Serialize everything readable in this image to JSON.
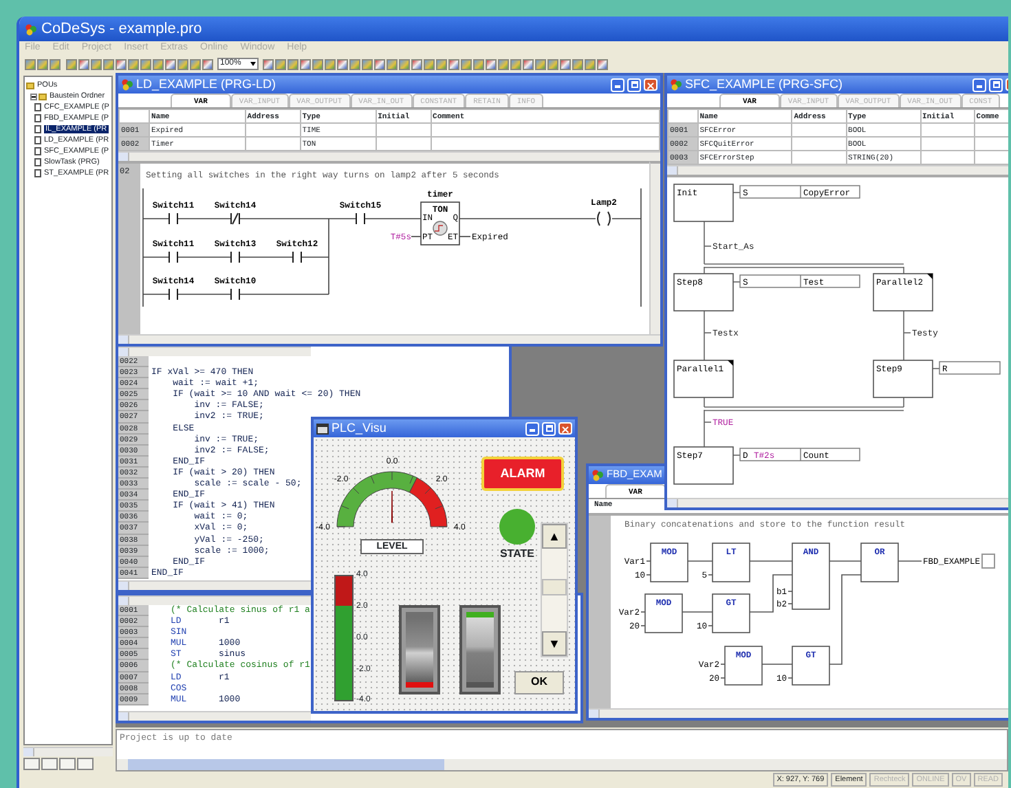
{
  "app": {
    "title": "CoDeSys - example.pro",
    "menu": [
      "File",
      "Edit",
      "Project",
      "Insert",
      "Extras",
      "Online",
      "Window",
      "Help"
    ],
    "zoom": "100%"
  },
  "pou_tree": {
    "label": "POUs",
    "children": [
      {
        "label": "Baustein Ordner",
        "expanded": true,
        "children": [
          {
            "label": "CFC_EXAMPLE (P",
            "selected": false
          },
          {
            "label": "FBD_EXAMPLE (P",
            "selected": false
          },
          {
            "label": "IL_EXAMPLE (PR",
            "selected": true
          },
          {
            "label": "LD_EXAMPLE (PR",
            "selected": false
          },
          {
            "label": "SFC_EXAMPLE (P",
            "selected": false
          },
          {
            "label": "SlowTask (PRG)",
            "selected": false
          },
          {
            "label": "ST_EXAMPLE (PR",
            "selected": false
          }
        ]
      }
    ]
  },
  "ld_window": {
    "title": "LD_EXAMPLE (PRG-LD)",
    "var_tabs": [
      {
        "label": "VAR",
        "selected": true
      },
      {
        "label": "VAR_INPUT",
        "selected": false
      },
      {
        "label": "VAR_OUTPUT",
        "selected": false
      },
      {
        "label": "VAR_IN_OUT",
        "selected": false
      },
      {
        "label": "CONSTANT",
        "selected": false
      },
      {
        "label": "RETAIN",
        "selected": false
      },
      {
        "label": "INFO",
        "selected": false
      }
    ],
    "columns": [
      "Name",
      "Address",
      "Type",
      "Initial",
      "Comment"
    ],
    "rows": [
      {
        "line": "0001",
        "name": "Expired",
        "type": "TIME"
      },
      {
        "line": "0002",
        "name": "Timer",
        "type": "TON"
      }
    ],
    "network": {
      "number": "02",
      "comment": "Setting all switches in the right way turns on lamp2 after 5 seconds",
      "branches": [
        [
          {
            "label": "Switch11",
            "negated": false
          },
          {
            "label": "Switch14",
            "negated": true
          }
        ],
        [
          {
            "label": "Switch11",
            "negated": false
          },
          {
            "label": "Switch13",
            "negated": false
          },
          {
            "label": "Switch12",
            "negated": false
          }
        ],
        [
          {
            "label": "Switch14",
            "negated": false
          },
          {
            "label": "Switch10",
            "negated": false
          }
        ]
      ],
      "series_contact": {
        "label": "Switch15",
        "negated": false
      },
      "block": {
        "instance": "timer",
        "type": "TON",
        "inputs": [
          "IN",
          "PT"
        ],
        "outputs": [
          "Q",
          "ET"
        ],
        "preset": "T#5s",
        "elapsed_output": "Expired"
      },
      "coil": "Lamp2"
    }
  },
  "st_window": {
    "lines": [
      {
        "line": "0022"
      },
      {
        "line": "0023",
        "code": "IF xVal >= 470 THEN"
      },
      {
        "line": "0024",
        "code": "    wait := wait +1;"
      },
      {
        "line": "0025",
        "code": "    IF (wait >= 10 AND wait <= 20) THEN"
      },
      {
        "line": "0026",
        "code": "        inv := FALSE;"
      },
      {
        "line": "0027",
        "code": "        inv2 := TRUE;"
      },
      {
        "line": "0028",
        "code": "    ELSE"
      },
      {
        "line": "0029",
        "code": "        inv := TRUE;"
      },
      {
        "line": "0030",
        "code": "        inv2 := FALSE;"
      },
      {
        "line": "0031",
        "code": "    END_IF"
      },
      {
        "line": "0032",
        "code": "    IF (wait > 20) THEN"
      },
      {
        "line": "0033",
        "code": "        scale := scale - 50;"
      },
      {
        "line": "0034",
        "code": "    END_IF"
      },
      {
        "line": "0035",
        "code": "    IF (wait > 41) THEN"
      },
      {
        "line": "0036",
        "code": "        wait := 0;"
      },
      {
        "line": "0037",
        "code": "        xVal := 0;"
      },
      {
        "line": "0038",
        "code": "        yVal := -250;"
      },
      {
        "line": "0039",
        "code": "        scale := 1000;"
      },
      {
        "line": "0040",
        "code": "    END_IF"
      },
      {
        "line": "0041",
        "code": "END_IF"
      }
    ]
  },
  "il_window": {
    "lines": [
      {
        "line": "0001",
        "kind": "comment",
        "text": "(* Calculate sinus of r1 a"
      },
      {
        "line": "0002",
        "kind": "instruction",
        "op": "LD",
        "operand": "r1"
      },
      {
        "line": "0003",
        "kind": "instruction",
        "op": "SIN"
      },
      {
        "line": "0004",
        "kind": "instruction",
        "op": "MUL",
        "operand": "1000"
      },
      {
        "line": "0005",
        "kind": "instruction",
        "op": "ST",
        "operand": "sinus"
      },
      {
        "line": "0006",
        "kind": "comment",
        "text": "(* Calculate cosinus of r1"
      },
      {
        "line": "0007",
        "kind": "instruction",
        "op": "LD",
        "operand": "r1"
      },
      {
        "line": "0008",
        "kind": "instruction",
        "op": "COS"
      },
      {
        "line": "0009",
        "kind": "instruction",
        "op": "MUL",
        "operand": "1000"
      }
    ]
  },
  "sfc_window": {
    "title": "SFC_EXAMPLE (PRG-SFC)",
    "var_tabs": [
      {
        "label": "VAR",
        "selected": true
      },
      {
        "label": "VAR_INPUT",
        "selected": false
      },
      {
        "label": "VAR_OUTPUT",
        "selected": false
      },
      {
        "label": "VAR_IN_OUT",
        "selected": false
      },
      {
        "label": "CONST",
        "selected": false
      }
    ],
    "columns": [
      "Name",
      "Address",
      "Type",
      "Initial",
      "Comme"
    ],
    "rows": [
      {
        "line": "0001",
        "name": "SFCError",
        "type": "BOOL"
      },
      {
        "line": "0002",
        "name": "SFCQuitError",
        "type": "BOOL"
      },
      {
        "line": "0003",
        "name": "SFCErrorStep",
        "type": "STRING(20)"
      }
    ],
    "steps": [
      {
        "name": "Init",
        "macro": false,
        "actions": [
          {
            "qualifier": "S",
            "variable": "CopyError"
          }
        ]
      },
      {
        "name": "Step8",
        "macro": false,
        "actions": [
          {
            "qualifier": "S",
            "variable": "Test"
          }
        ]
      },
      {
        "name": "Parallel2",
        "macro": true
      },
      {
        "name": "Parallel1",
        "macro": true
      },
      {
        "name": "Step9",
        "macro": false,
        "actions": [
          {
            "qualifier": "R"
          }
        ]
      },
      {
        "name": "Step7",
        "macro": false,
        "actions": [
          {
            "qualifier": "D",
            "time": "T#2s",
            "variable": "Count"
          }
        ]
      }
    ],
    "transitions": [
      {
        "label": "Start_As",
        "kind": "variable"
      },
      {
        "label": "Testx",
        "kind": "variable"
      },
      {
        "label": "Testy",
        "kind": "variable"
      },
      {
        "label": "TRUE",
        "kind": "literal"
      }
    ]
  },
  "fbd_window": {
    "title": "FBD_EXAM",
    "var_tab": "VAR",
    "column": "Name",
    "comment": "Binary concatenations and store to the function result",
    "blocks": [
      {
        "type": "MOD",
        "inputs": [
          "Var1",
          "10"
        ]
      },
      {
        "type": "LT",
        "inputs": [
          "5"
        ]
      },
      {
        "type": "AND",
        "inputs": [
          "b1",
          "b2"
        ]
      },
      {
        "type": "OR"
      },
      {
        "type": "MOD",
        "inputs": [
          "Var2",
          "20"
        ]
      },
      {
        "type": "GT",
        "inputs": [
          "10"
        ]
      },
      {
        "type": "MOD",
        "inputs": [
          "Var2",
          "20"
        ]
      },
      {
        "type": "GT",
        "inputs": [
          "10"
        ]
      }
    ],
    "output": "FBD_EXAMPLE"
  },
  "visu_window": {
    "title": "PLC_Visu",
    "gauge": {
      "ticks": [
        "-4.0",
        "-2.0",
        "0.0",
        "2.0",
        "4.0"
      ],
      "level": 0.5,
      "label": "LEVEL"
    },
    "alarm_button": "ALARM",
    "state_lamp": {
      "on": true,
      "label": "STATE"
    },
    "bar_meter": {
      "ticks": [
        "4.0",
        "2.0",
        "0.0",
        "-2.0",
        "-4.0"
      ],
      "level": 1
    },
    "switches": [
      {
        "on": false
      },
      {
        "on": true
      }
    ],
    "scroll": {
      "up": "▲",
      "down": "▼"
    },
    "ok_button": "OK"
  },
  "message_pane": {
    "text": "Project is up to date"
  },
  "status_bar": [
    {
      "text": "X: 927, Y: 769",
      "disabled": false
    },
    {
      "text": "Element",
      "disabled": false
    },
    {
      "text": "Rechteck",
      "disabled": true
    },
    {
      "text": "ONLINE",
      "disabled": true
    },
    {
      "text": "OV",
      "disabled": true
    },
    {
      "text": "READ",
      "disabled": true
    }
  ]
}
